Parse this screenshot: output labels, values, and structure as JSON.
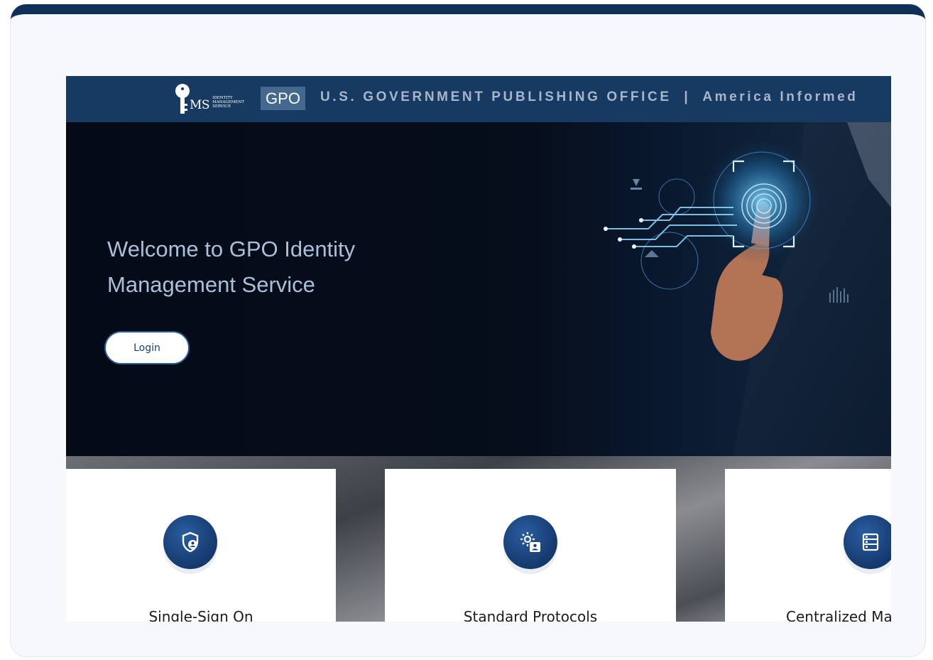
{
  "header": {
    "logo_ms": "MS",
    "logo_subtitle": [
      "IDENTITY",
      "MANAGEMENT",
      "SERVICE"
    ],
    "gpo_label": "GPO",
    "tagline": "U.S. GOVERNMENT PUBLISHING OFFICE  |  America Informed"
  },
  "hero": {
    "title": "Welcome to GPO Identity Management Service",
    "login_label": "Login"
  },
  "cards": [
    {
      "title": "Single-Sign On",
      "icon": "shield-user-icon"
    },
    {
      "title": "Standard Protocols",
      "icon": "gear-badge-icon"
    },
    {
      "title": "Centralized Management",
      "icon": "server-list-icon"
    }
  ],
  "colors": {
    "frame_top": "#0f2f56",
    "header_bg": "#173a63",
    "gpo_box": "#44698f",
    "hero_text": "#a9c0da",
    "accent": "#2d5d96"
  }
}
